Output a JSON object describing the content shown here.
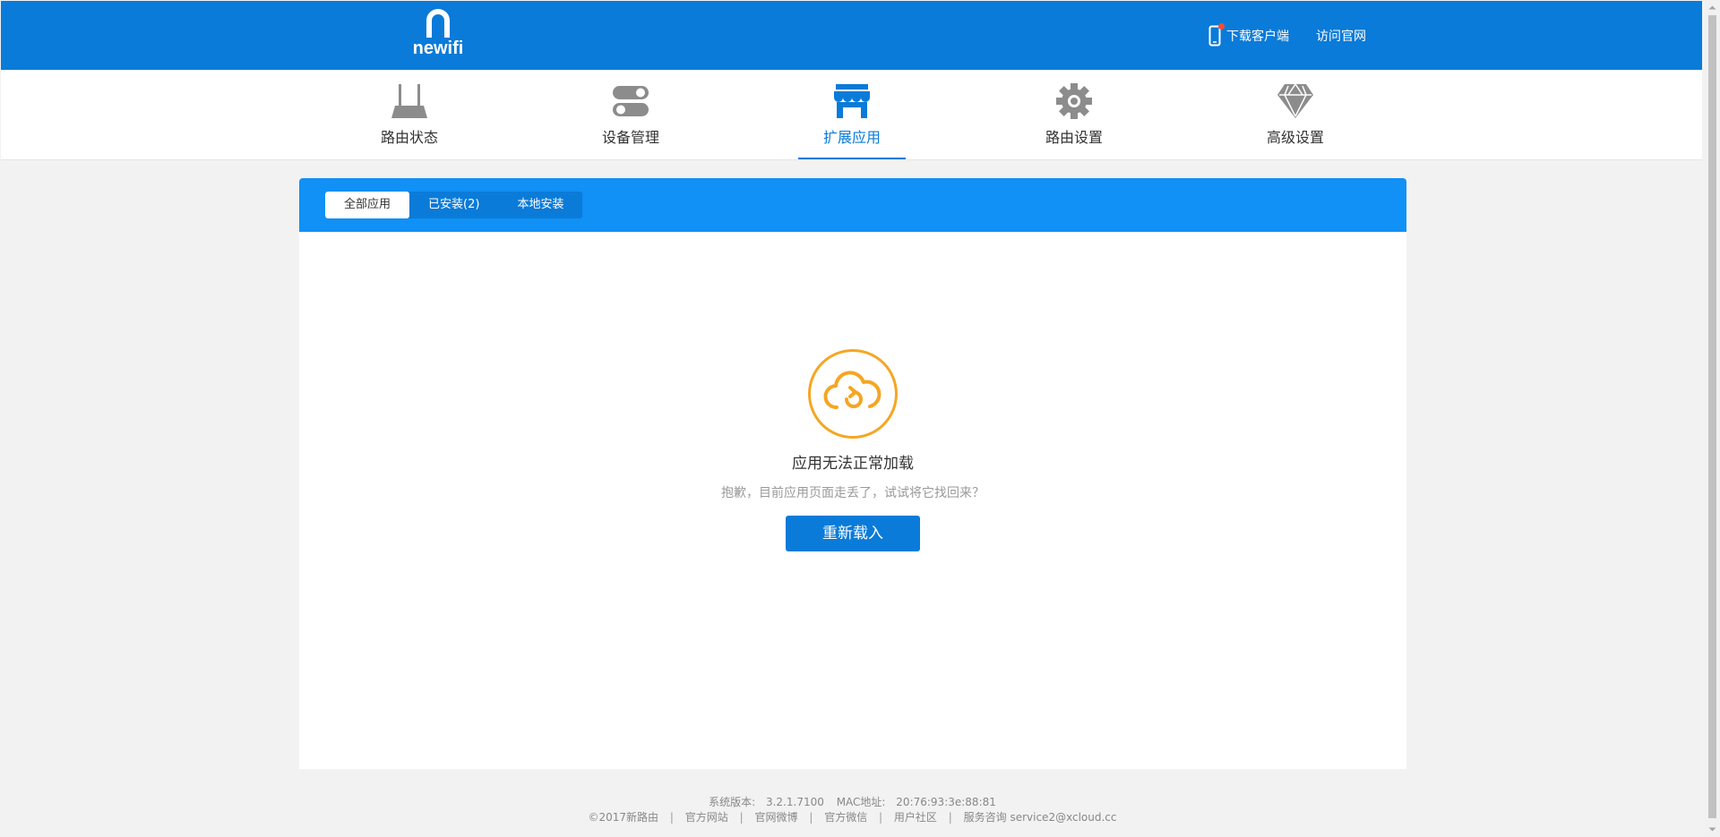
{
  "header": {
    "logo_text": "newifi",
    "download_client": "下载客户端",
    "visit_site": "访问官网"
  },
  "nav": {
    "items": [
      {
        "label": "路由状态",
        "icon": "router-icon"
      },
      {
        "label": "设备管理",
        "icon": "toggle-icon"
      },
      {
        "label": "扩展应用",
        "icon": "store-icon",
        "active": true
      },
      {
        "label": "路由设置",
        "icon": "gear-icon"
      },
      {
        "label": "高级设置",
        "icon": "diamond-icon"
      }
    ]
  },
  "tabs": {
    "all": "全部应用",
    "installed": "已安装(2)",
    "local": "本地安装"
  },
  "error": {
    "title": "应用无法正常加载",
    "message": "抱歉，目前应用页面走丢了，试试将它找回来？",
    "reload": "重新载入"
  },
  "footer": {
    "version_label": "系统版本:",
    "version": "3.2.1.7100",
    "mac_label": "MAC地址:",
    "mac": "20:76:93:3e:88:81",
    "copyright": "©2017新路由",
    "links": [
      "官方网站",
      "官网微博",
      "官方微信",
      "用户社区"
    ],
    "service": "服务咨询 service2@xcloud.cc"
  },
  "colors": {
    "brand": "#0a7bd8",
    "panel_header": "#1190f5",
    "warning": "#f5a623"
  }
}
